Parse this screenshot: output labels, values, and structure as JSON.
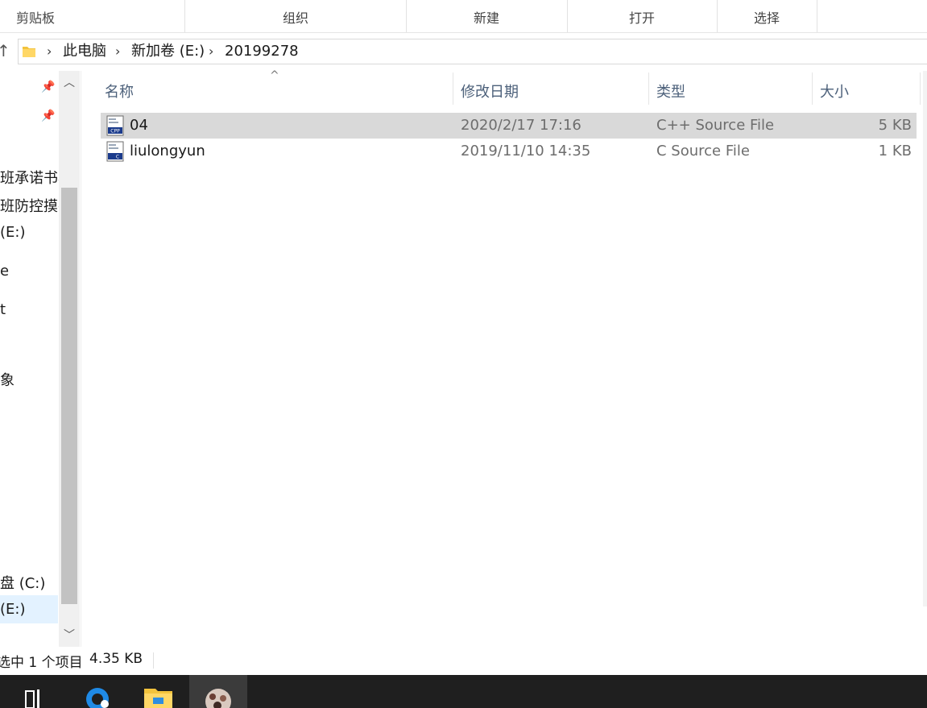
{
  "ribbon": {
    "groups": [
      "剪贴板",
      "组织",
      "新建",
      "打开",
      "选择"
    ]
  },
  "address": {
    "crumbs": [
      "此电脑",
      "新加卷 (E:)",
      "20199278"
    ],
    "up_icon": "up-arrow-icon",
    "separator": "›"
  },
  "nav": {
    "items": [
      "班承诺书看",
      "班防控摸排",
      "(E:)",
      "e",
      "t",
      "象",
      "盘 (C:)",
      "(E:)"
    ],
    "scroll_up": "︿",
    "scroll_down": "﹀",
    "pin_icon": "📌"
  },
  "columns": {
    "name": "名称",
    "date": "修改日期",
    "type": "类型",
    "size": "大小",
    "sort_caret": "^"
  },
  "files": [
    {
      "name": "04",
      "date": "2020/2/17 17:16",
      "type": "C++ Source File",
      "size": "5 KB",
      "icon": "cpp-file-icon",
      "icon_label": "CPP",
      "selected": true
    },
    {
      "name": "liulongyun",
      "date": "2019/11/10 14:35",
      "type": "C Source File",
      "size": "1 KB",
      "icon": "c-file-icon",
      "icon_label": "C",
      "selected": false
    }
  ],
  "status": {
    "selection": "选中 1 个项目",
    "size": "4.35 KB"
  },
  "colors": {
    "selected_row": "#d9d9d9",
    "header_text": "#4c607a",
    "taskbar": "#1f1f1f"
  }
}
